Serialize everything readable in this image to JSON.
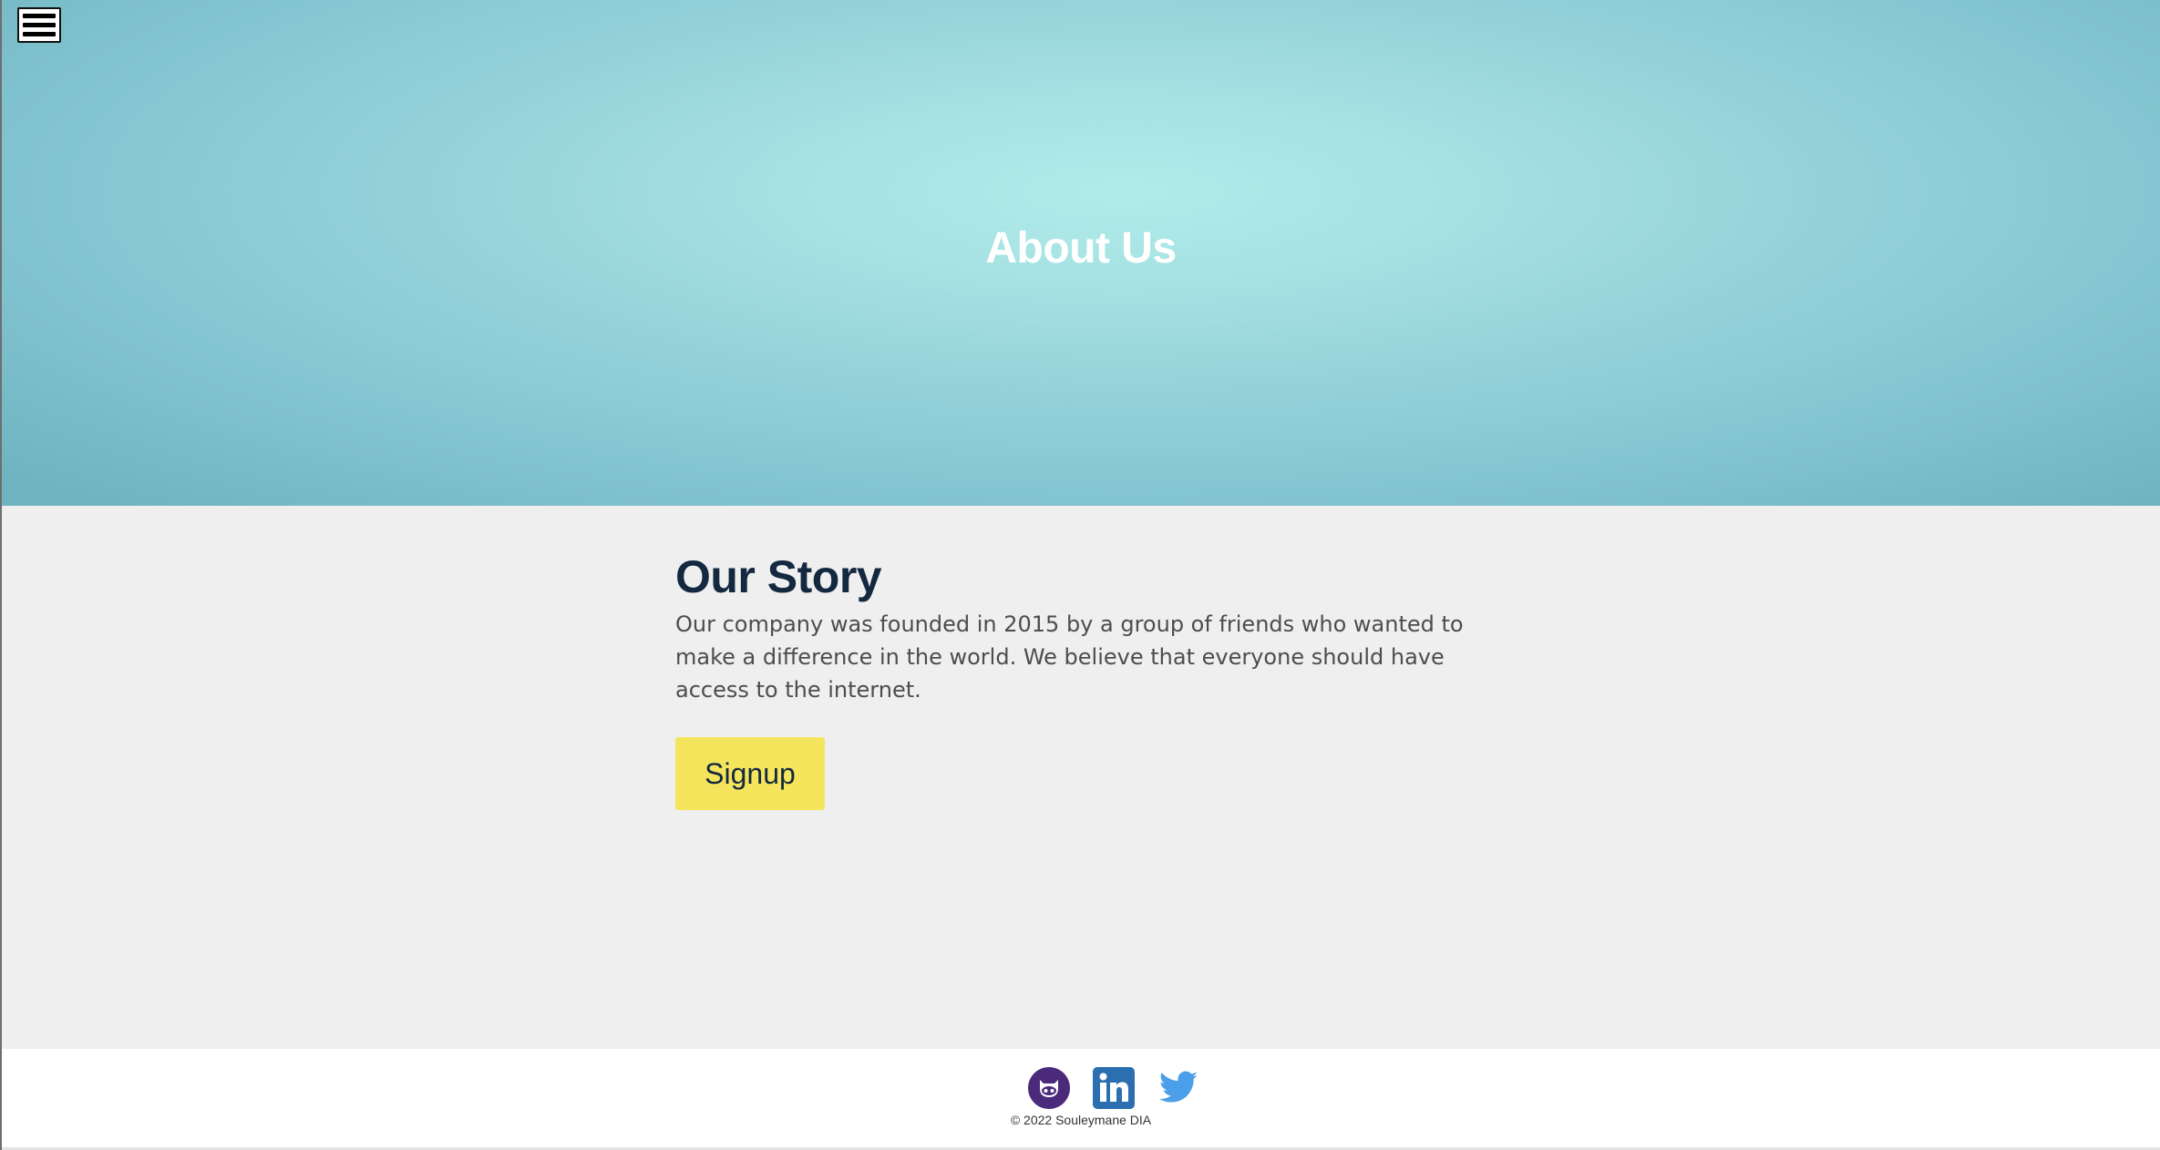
{
  "menu": {
    "icon": "hamburger-menu-icon"
  },
  "hero": {
    "title": "About Us"
  },
  "story": {
    "title": "Our Story",
    "text": "Our company was founded in 2015 by a group of friends who wanted to make a difference in the world. We believe that everyone should have access to the internet.",
    "signup_label": "Signup"
  },
  "footer": {
    "social": [
      {
        "icon": "github-icon",
        "color": "#4b2a7b"
      },
      {
        "icon": "linkedin-icon",
        "color": "#2c6fb0"
      },
      {
        "icon": "twitter-icon",
        "color": "#4a9fe8"
      }
    ],
    "copyright": "© 2022 Souleymane DIA"
  },
  "colors": {
    "hero_center": "#b1ecea",
    "hero_edge": "#6fb3c0",
    "section_bg": "#efefef",
    "title": "#14283f",
    "body_text": "#4d4d4d",
    "button_bg": "#f5e55d"
  }
}
